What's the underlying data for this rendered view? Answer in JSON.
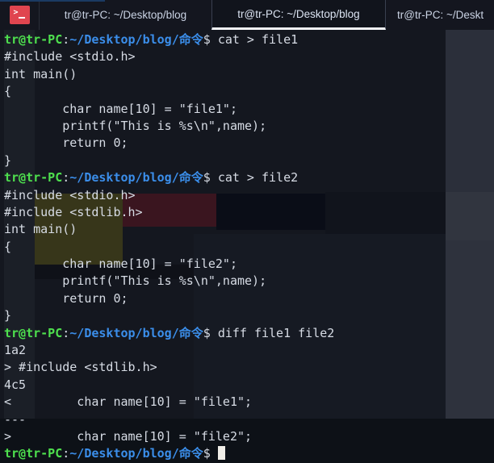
{
  "window": {
    "app_icon": "terminal-icon",
    "tabs": [
      {
        "label": "tr@tr-PC: ~/Desktop/blog",
        "active": false
      },
      {
        "label": "tr@tr-PC: ~/Desktop/blog",
        "active": true
      },
      {
        "label": "tr@tr-PC: ~/Deskt",
        "active": false
      }
    ]
  },
  "prompt": {
    "user_host": "tr@tr-PC",
    "colon": ":",
    "path": "~/Desktop/blog/命令",
    "sigil": "$"
  },
  "colors": {
    "background": "#14171f",
    "desktop": "#2b2f3a",
    "tabbar": "#14161f",
    "prompt_user": "#4ee04e",
    "prompt_path": "#3b8eea",
    "text": "#d7dce5",
    "icon_red": "#e0454f",
    "active_tab_underline": "#f2f4f8"
  },
  "terminal_lines": [
    {
      "type": "prompt",
      "command": "cat > file1"
    },
    {
      "type": "output",
      "text": "#include <stdio.h>"
    },
    {
      "type": "output",
      "text": "int main()"
    },
    {
      "type": "output",
      "text": "{"
    },
    {
      "type": "output",
      "text": "        char name[10] = \"file1\";"
    },
    {
      "type": "output",
      "text": "        printf(\"This is %s\\n\",name);"
    },
    {
      "type": "output",
      "text": "        return 0;"
    },
    {
      "type": "output",
      "text": "}"
    },
    {
      "type": "prompt",
      "command": "cat > file2"
    },
    {
      "type": "output",
      "text": "#include <stdio.h>"
    },
    {
      "type": "output",
      "text": "#include <stdlib.h>"
    },
    {
      "type": "output",
      "text": "int main()"
    },
    {
      "type": "output",
      "text": "{"
    },
    {
      "type": "output",
      "text": "        char name[10] = \"file2\";"
    },
    {
      "type": "output",
      "text": "        printf(\"This is %s\\n\",name);"
    },
    {
      "type": "output",
      "text": "        return 0;"
    },
    {
      "type": "output",
      "text": "}"
    },
    {
      "type": "prompt",
      "command": "diff file1 file2"
    },
    {
      "type": "output",
      "text": "1a2"
    },
    {
      "type": "output",
      "text": "> #include <stdlib.h>"
    },
    {
      "type": "output",
      "text": "4c5"
    },
    {
      "type": "output",
      "text": "<         char name[10] = \"file1\";"
    },
    {
      "type": "output",
      "text": "---"
    },
    {
      "type": "output",
      "text": ">         char name[10] = \"file2\";"
    },
    {
      "type": "prompt",
      "command": "",
      "cursor": true
    }
  ]
}
